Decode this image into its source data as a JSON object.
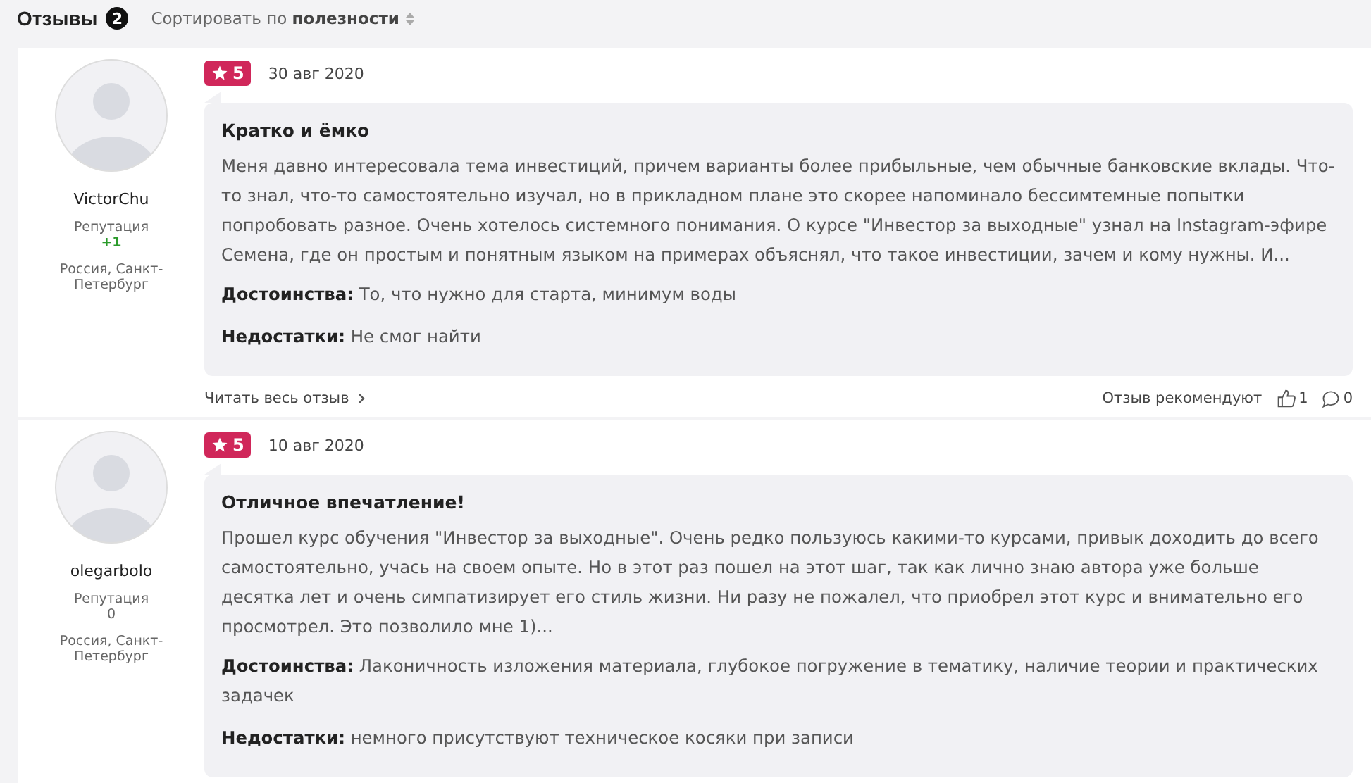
{
  "header": {
    "title": "Отзывы",
    "count": "2",
    "sort": "Сортировать по **полезности**"
  },
  "reviews": [
    {
      "author": {
        "name": "VictorChu",
        "reputation_label": "Репутация",
        "reputation": "+1",
        "reputation_positive": true,
        "location": "Россия, Санкт-Петербург"
      },
      "rating": "5",
      "date": "30 авг 2020",
      "title": "Кратко и ёмко",
      "text": "Меня давно интересовала тема инвестиций, причем варианты более прибыльные, чем обычные банковские вклады. Что-то знал, что-то самостоятельно изучал, но в прикладном плане это скорее напоминало бессимтемные попытки попробовать разное. Очень хотелось системного понимания. О курсе \"Инвестор за выходные\" узнал на Instagram-эфире Семена, где он простым и понятным языком на примерах объяснял, что такое инвестиции, зачем и кому нужны. И...",
      "pros_label": "Достоинства:",
      "pros": "То, что нужно для старта, минимум воды",
      "cons_label": "Недостатки:",
      "cons": "Не смог найти",
      "read_more": "Читать весь отзыв",
      "recommend_label": "Отзыв рекомендуют",
      "likes": "1",
      "comments": "0"
    },
    {
      "author": {
        "name": "olegarbolo",
        "reputation_label": "Репутация",
        "reputation": "0",
        "reputation_positive": false,
        "location": "Россия, Санкт-Петербург"
      },
      "rating": "5",
      "date": "10 авг 2020",
      "title": "Отличное впечатление!",
      "text": "Прошел курс обучения \"Инвестор за выходные\". Очень редко пользуюсь какими-то курсами, привык доходить до всего самостоятельно, учась на своем опыте. Но в этот раз пошел на этот шаг, так как лично знаю автора уже больше десятка лет и очень симпатизирует его стиль жизни. Ни разу не пожалел, что приобрел этот курс и внимательно его просмотрел. Это позволило мне 1)...",
      "pros_label": "Достоинства:",
      "pros": "Лаконичность изложения материала, глубокое погружение в тематику, наличие теории и практических задачек",
      "cons_label": "Недостатки:",
      "cons": "немного присутствуют техническое косяки при записи"
    }
  ]
}
